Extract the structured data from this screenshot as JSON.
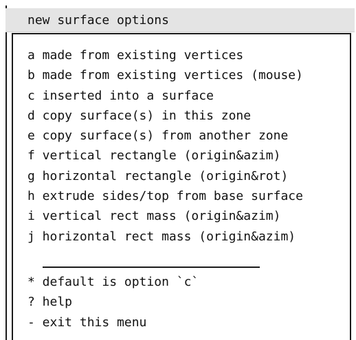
{
  "window": {
    "title": "new surface options"
  },
  "menu": {
    "items": [
      "a made from existing vertices",
      "b made from existing vertices (mouse)",
      "c inserted into a surface",
      "d copy surface(s) in this zone",
      "e copy surface(s) from another zone",
      "f vertical rectangle (origin&azim)",
      "g horizontal rectangle (origin&rot)",
      "h extrude sides/top from base surface",
      "i vertical rect mass (origin&azim)",
      "j horizontal rect mass (origin&azim)"
    ],
    "footer": [
      "* default is option `c`",
      "? help",
      "- exit this menu"
    ]
  },
  "colors": {
    "title_bar_bg": "#e4e4e4",
    "text": "#111111",
    "border": "#1a1a1a",
    "background": "#ffffff"
  }
}
